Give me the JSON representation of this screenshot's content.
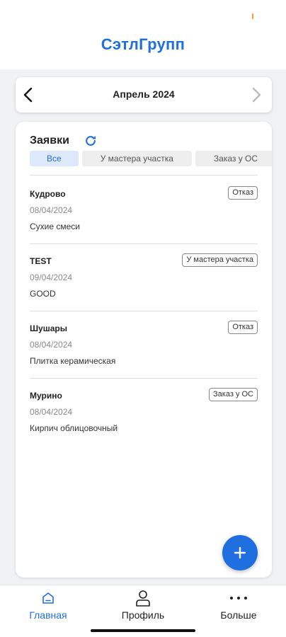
{
  "app": {
    "title": "СэтлГрупп"
  },
  "month_selector": {
    "label": "Апрель 2024",
    "prev_icon": "chevron-left-icon",
    "next_icon": "chevron-right-icon"
  },
  "requests": {
    "title": "Заявки",
    "refresh_icon": "refresh-icon",
    "filters": [
      "Все",
      "У мастера участка",
      "Заказ у ОС"
    ],
    "active_filter": "Все",
    "items": [
      {
        "name": "Кудрово",
        "date": "08/04/2024",
        "description": "Сухие смеси",
        "status": "Отказ"
      },
      {
        "name": "TEST",
        "date": "09/04/2024",
        "description": "GOOD",
        "status": "У мастера участка"
      },
      {
        "name": "Шушары",
        "date": "08/04/2024",
        "description": "Плитка керамическая",
        "status": "Отказ"
      },
      {
        "name": "Мурино",
        "date": "08/04/2024",
        "description": "Кирпич облицовочный",
        "status": "Заказ у ОС"
      }
    ]
  },
  "fab": {
    "label": "+",
    "icon": "plus-icon"
  },
  "bottom_nav": {
    "items": [
      {
        "label": "Главная",
        "icon": "home-icon"
      },
      {
        "label": "Профиль",
        "icon": "person-icon"
      },
      {
        "label": "Больше",
        "icon": "more-icon"
      }
    ],
    "active": "Главная"
  },
  "colors": {
    "accent": "#1f6fe0",
    "background": "#f1f2f4",
    "active_chip_bg": "#dde8fb"
  }
}
